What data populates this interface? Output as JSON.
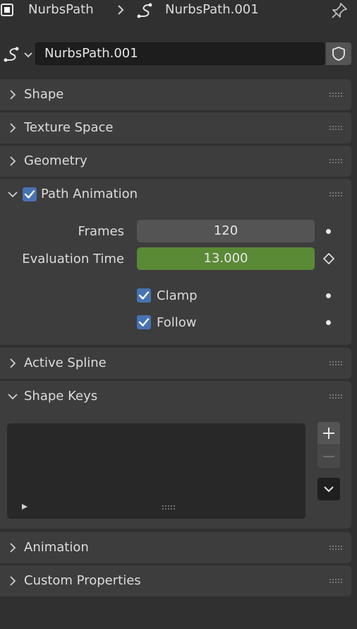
{
  "breadcrumb": {
    "object_name": "NurbsPath",
    "data_name": "NurbsPath.001"
  },
  "datablock": {
    "name_value": "NurbsPath.001"
  },
  "panels": {
    "shape": "Shape",
    "texture_space": "Texture Space",
    "geometry": "Geometry",
    "path_animation": "Path Animation",
    "active_spline": "Active Spline",
    "shape_keys": "Shape Keys",
    "animation": "Animation",
    "custom_properties": "Custom Properties"
  },
  "path_animation": {
    "enabled": true,
    "frames_label": "Frames",
    "frames_value": "120",
    "eval_time_label": "Evaluation Time",
    "eval_time_value": "13.000",
    "clamp_label": "Clamp",
    "clamp_checked": true,
    "follow_label": "Follow",
    "follow_checked": true
  },
  "colors": {
    "background": "#303030",
    "panel": "#3d3d3d",
    "checkbox_accent": "#4772b3",
    "animated_field": "#5b8a36"
  },
  "icons": {
    "object": "object-icon",
    "curve": "curve-icon",
    "pin": "pin-icon",
    "shield": "fake-user-shield-icon",
    "chevron_right": "chevron-right-icon",
    "chevron_down": "chevron-down-icon",
    "grip": "drag-grip-icon",
    "keyframe": "keyframe-diamond-icon",
    "add": "plus-icon",
    "remove": "minus-icon",
    "menu": "dropdown-menu-icon"
  }
}
